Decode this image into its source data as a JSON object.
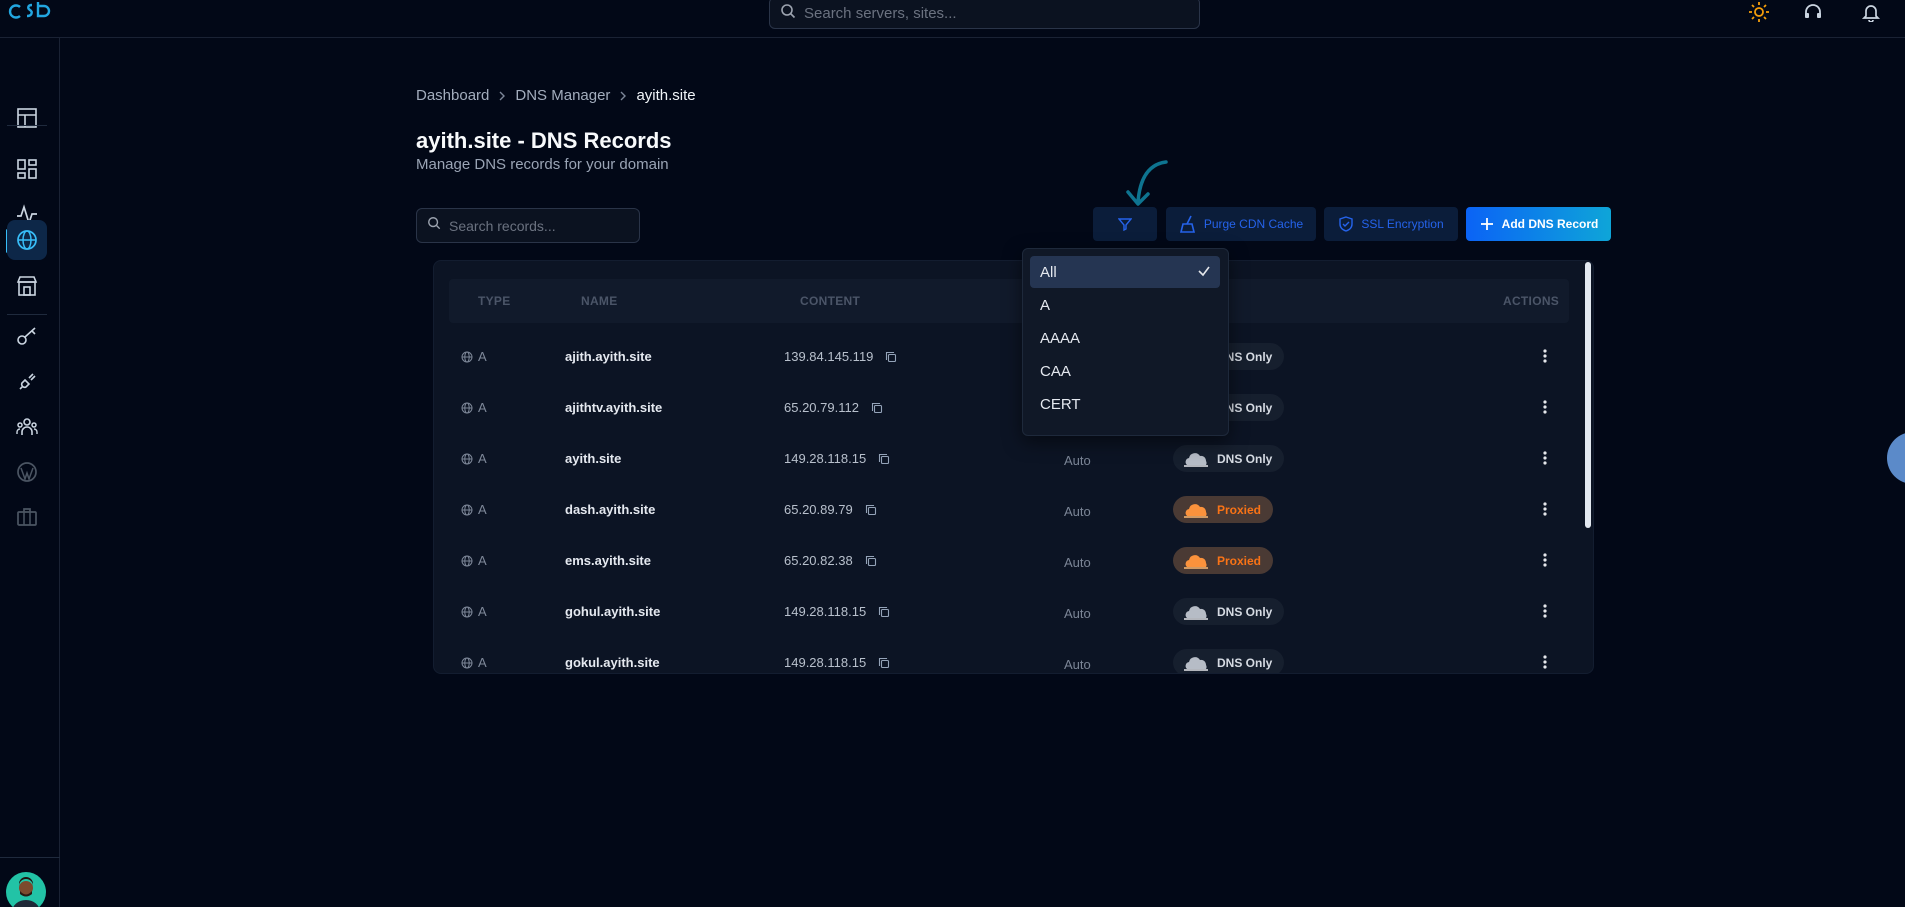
{
  "header": {
    "brand": "cSb",
    "search_placeholder": "Search servers, sites..."
  },
  "sidebar": {
    "items": [
      {
        "icon": "dashboard-icon"
      },
      {
        "icon": "apps-grid-icon"
      },
      {
        "icon": "activity-icon"
      },
      {
        "icon": "globe-icon",
        "active": true
      },
      {
        "icon": "store-icon"
      },
      {
        "icon": "key-icon"
      },
      {
        "icon": "plug-icon"
      },
      {
        "icon": "team-icon"
      },
      {
        "icon": "wordpress-icon"
      },
      {
        "icon": "briefcase-icon"
      }
    ]
  },
  "breadcrumb": {
    "items": [
      "Dashboard",
      "DNS Manager",
      "ayith.site"
    ]
  },
  "page": {
    "title": "ayith.site - DNS Records",
    "subtitle": "Manage DNS records for your domain"
  },
  "records_search": {
    "placeholder": "Search records..."
  },
  "toolbar": {
    "purge_label": "Purge CDN Cache",
    "ssl_label": "SSL Encryption",
    "add_label": "Add DNS Record"
  },
  "table": {
    "headers": {
      "type": "TYPE",
      "name": "NAME",
      "content": "CONTENT",
      "actions": "ACTIONS"
    },
    "rows": [
      {
        "type": "A",
        "name": "ajith.ayith.site",
        "content": "139.84.145.119",
        "ttl": "",
        "proxy": "DNS Only"
      },
      {
        "type": "A",
        "name": "ajithtv.ayith.site",
        "content": "65.20.79.112",
        "ttl": "",
        "proxy": "DNS Only"
      },
      {
        "type": "A",
        "name": "ayith.site",
        "content": "149.28.118.15",
        "ttl": "Auto",
        "proxy": "DNS Only"
      },
      {
        "type": "A",
        "name": "dash.ayith.site",
        "content": "65.20.89.79",
        "ttl": "Auto",
        "proxy": "Proxied"
      },
      {
        "type": "A",
        "name": "ems.ayith.site",
        "content": "65.20.82.38",
        "ttl": "Auto",
        "proxy": "Proxied"
      },
      {
        "type": "A",
        "name": "gohul.ayith.site",
        "content": "149.28.118.15",
        "ttl": "Auto",
        "proxy": "DNS Only"
      },
      {
        "type": "A",
        "name": "gokul.ayith.site",
        "content": "149.28.118.15",
        "ttl": "Auto",
        "proxy": "DNS Only"
      }
    ]
  },
  "type_filter": {
    "options": [
      "All",
      "A",
      "AAAA",
      "CAA",
      "CERT"
    ],
    "selected": "All"
  },
  "colors": {
    "background": "#020817",
    "accent": "#0ea5e9",
    "primary_button": "#0b63f6",
    "proxied": "#f97316"
  }
}
